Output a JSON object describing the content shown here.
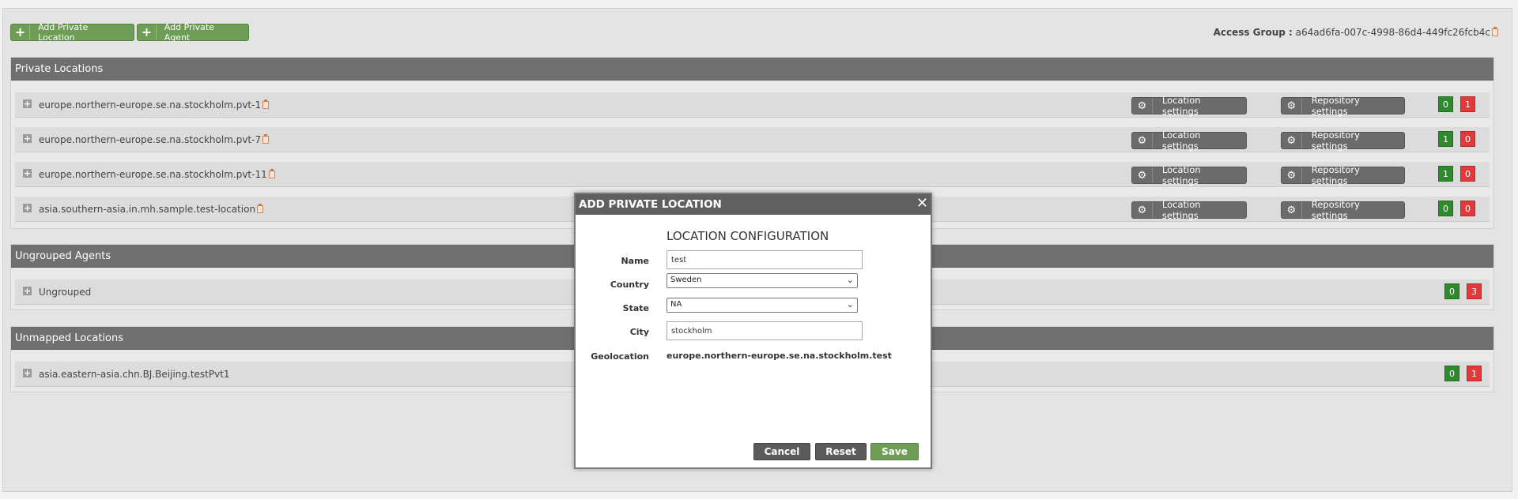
{
  "toolbar": {
    "add_location_label": "Add Private Location",
    "add_agent_label": "Add Private Agent",
    "access_group_label": "Access Group :",
    "access_group_value": "a64ad6fa-007c-4998-86d4-449fc26fcb4c"
  },
  "private_locations": {
    "title": "Private Locations",
    "location_settings_label": "Location settings",
    "repository_settings_label": "Repository settings",
    "items": [
      {
        "name": "europe.northern-europe.se.na.stockholm.pvt-1",
        "green": "0",
        "red": "1"
      },
      {
        "name": "europe.northern-europe.se.na.stockholm.pvt-7",
        "green": "1",
        "red": "0"
      },
      {
        "name": "europe.northern-europe.se.na.stockholm.pvt-11",
        "green": "1",
        "red": "0"
      },
      {
        "name": "asia.southern-asia.in.mh.sample.test-location",
        "green": "0",
        "red": "0"
      }
    ]
  },
  "ungrouped_agents": {
    "title": "Ungrouped Agents",
    "items": [
      {
        "name": "Ungrouped",
        "green": "0",
        "red": "3"
      }
    ]
  },
  "unmapped_locations": {
    "title": "Unmapped Locations",
    "items": [
      {
        "name": "asia.eastern-asia.chn.BJ.Beijing.testPvt1",
        "green": "0",
        "red": "1"
      }
    ]
  },
  "modal": {
    "title": "ADD PRIVATE LOCATION",
    "close": "✕",
    "section_title": "LOCATION CONFIGURATION",
    "name_label": "Name",
    "name_value": "test",
    "country_label": "Country",
    "country_value": "Sweden",
    "state_label": "State",
    "state_value": "NA",
    "city_label": "City",
    "city_value": "stockholm",
    "geolocation_label": "Geolocation",
    "geolocation_value": "europe.northern-europe.se.na.stockholm.test",
    "cancel_label": "Cancel",
    "reset_label": "Reset",
    "save_label": "Save"
  },
  "colors": {
    "accent_green": "#6e9e55",
    "header_gray": "#6f6f6f",
    "badge_green": "#2f8a2e",
    "badge_red": "#e03a3a"
  }
}
